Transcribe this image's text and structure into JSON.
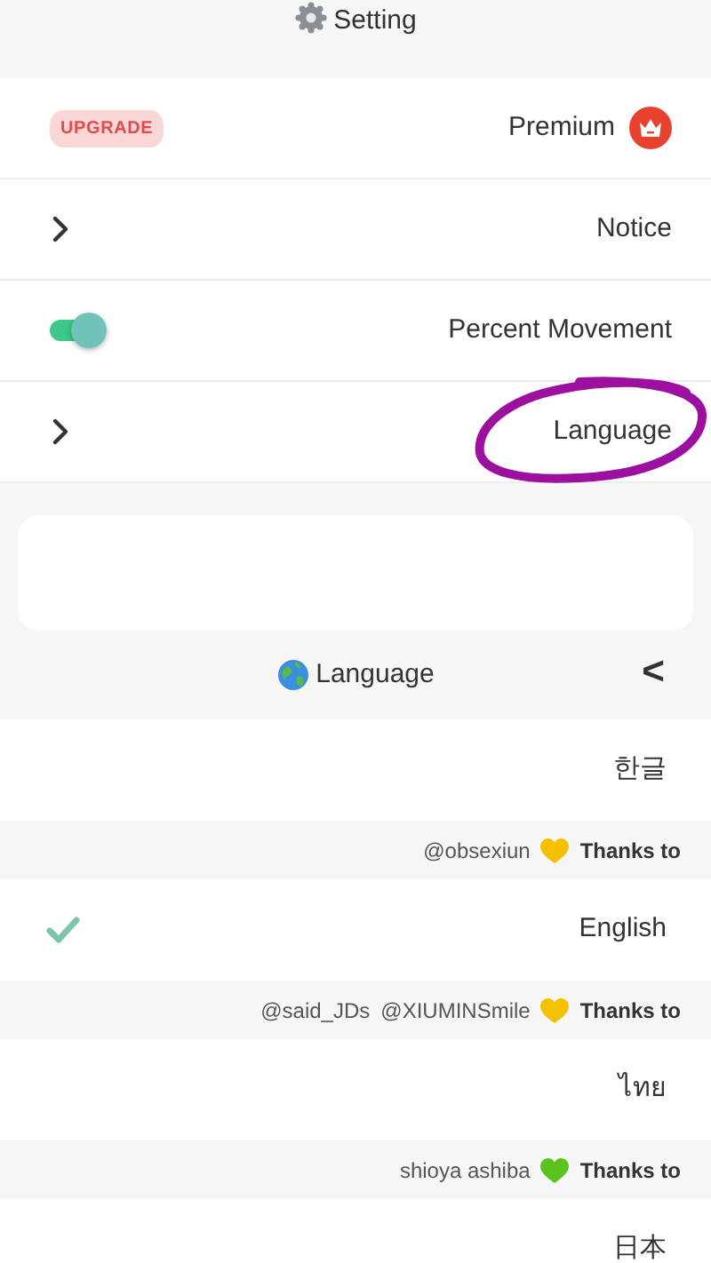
{
  "header": {
    "title": "Setting"
  },
  "settings": [
    {
      "kind": "premium",
      "label": "Premium",
      "badge": "UPGRADE"
    },
    {
      "kind": "link",
      "label": "Notice"
    },
    {
      "kind": "toggle",
      "label": "Percent Movement",
      "on": true
    },
    {
      "kind": "link",
      "label": "Language",
      "circled": true
    }
  ],
  "language_panel": {
    "title": "Language",
    "back": "<"
  },
  "languages": [
    {
      "label": "한글",
      "selected": false,
      "thanks": {
        "names": [
          "@obsexiun"
        ],
        "color": "#f5c000",
        "label": "Thanks to"
      }
    },
    {
      "label": "English",
      "selected": true,
      "thanks": {
        "names": [
          "@said_JDs",
          "@XIUMINSmile"
        ],
        "color": "#f5c000",
        "label": "Thanks to"
      }
    },
    {
      "label": "ไทย",
      "selected": false,
      "thanks": {
        "names": [
          "shioya ashiba"
        ],
        "color": "#5cc21c",
        "label": "Thanks to"
      }
    },
    {
      "label": "日本",
      "selected": false
    }
  ]
}
